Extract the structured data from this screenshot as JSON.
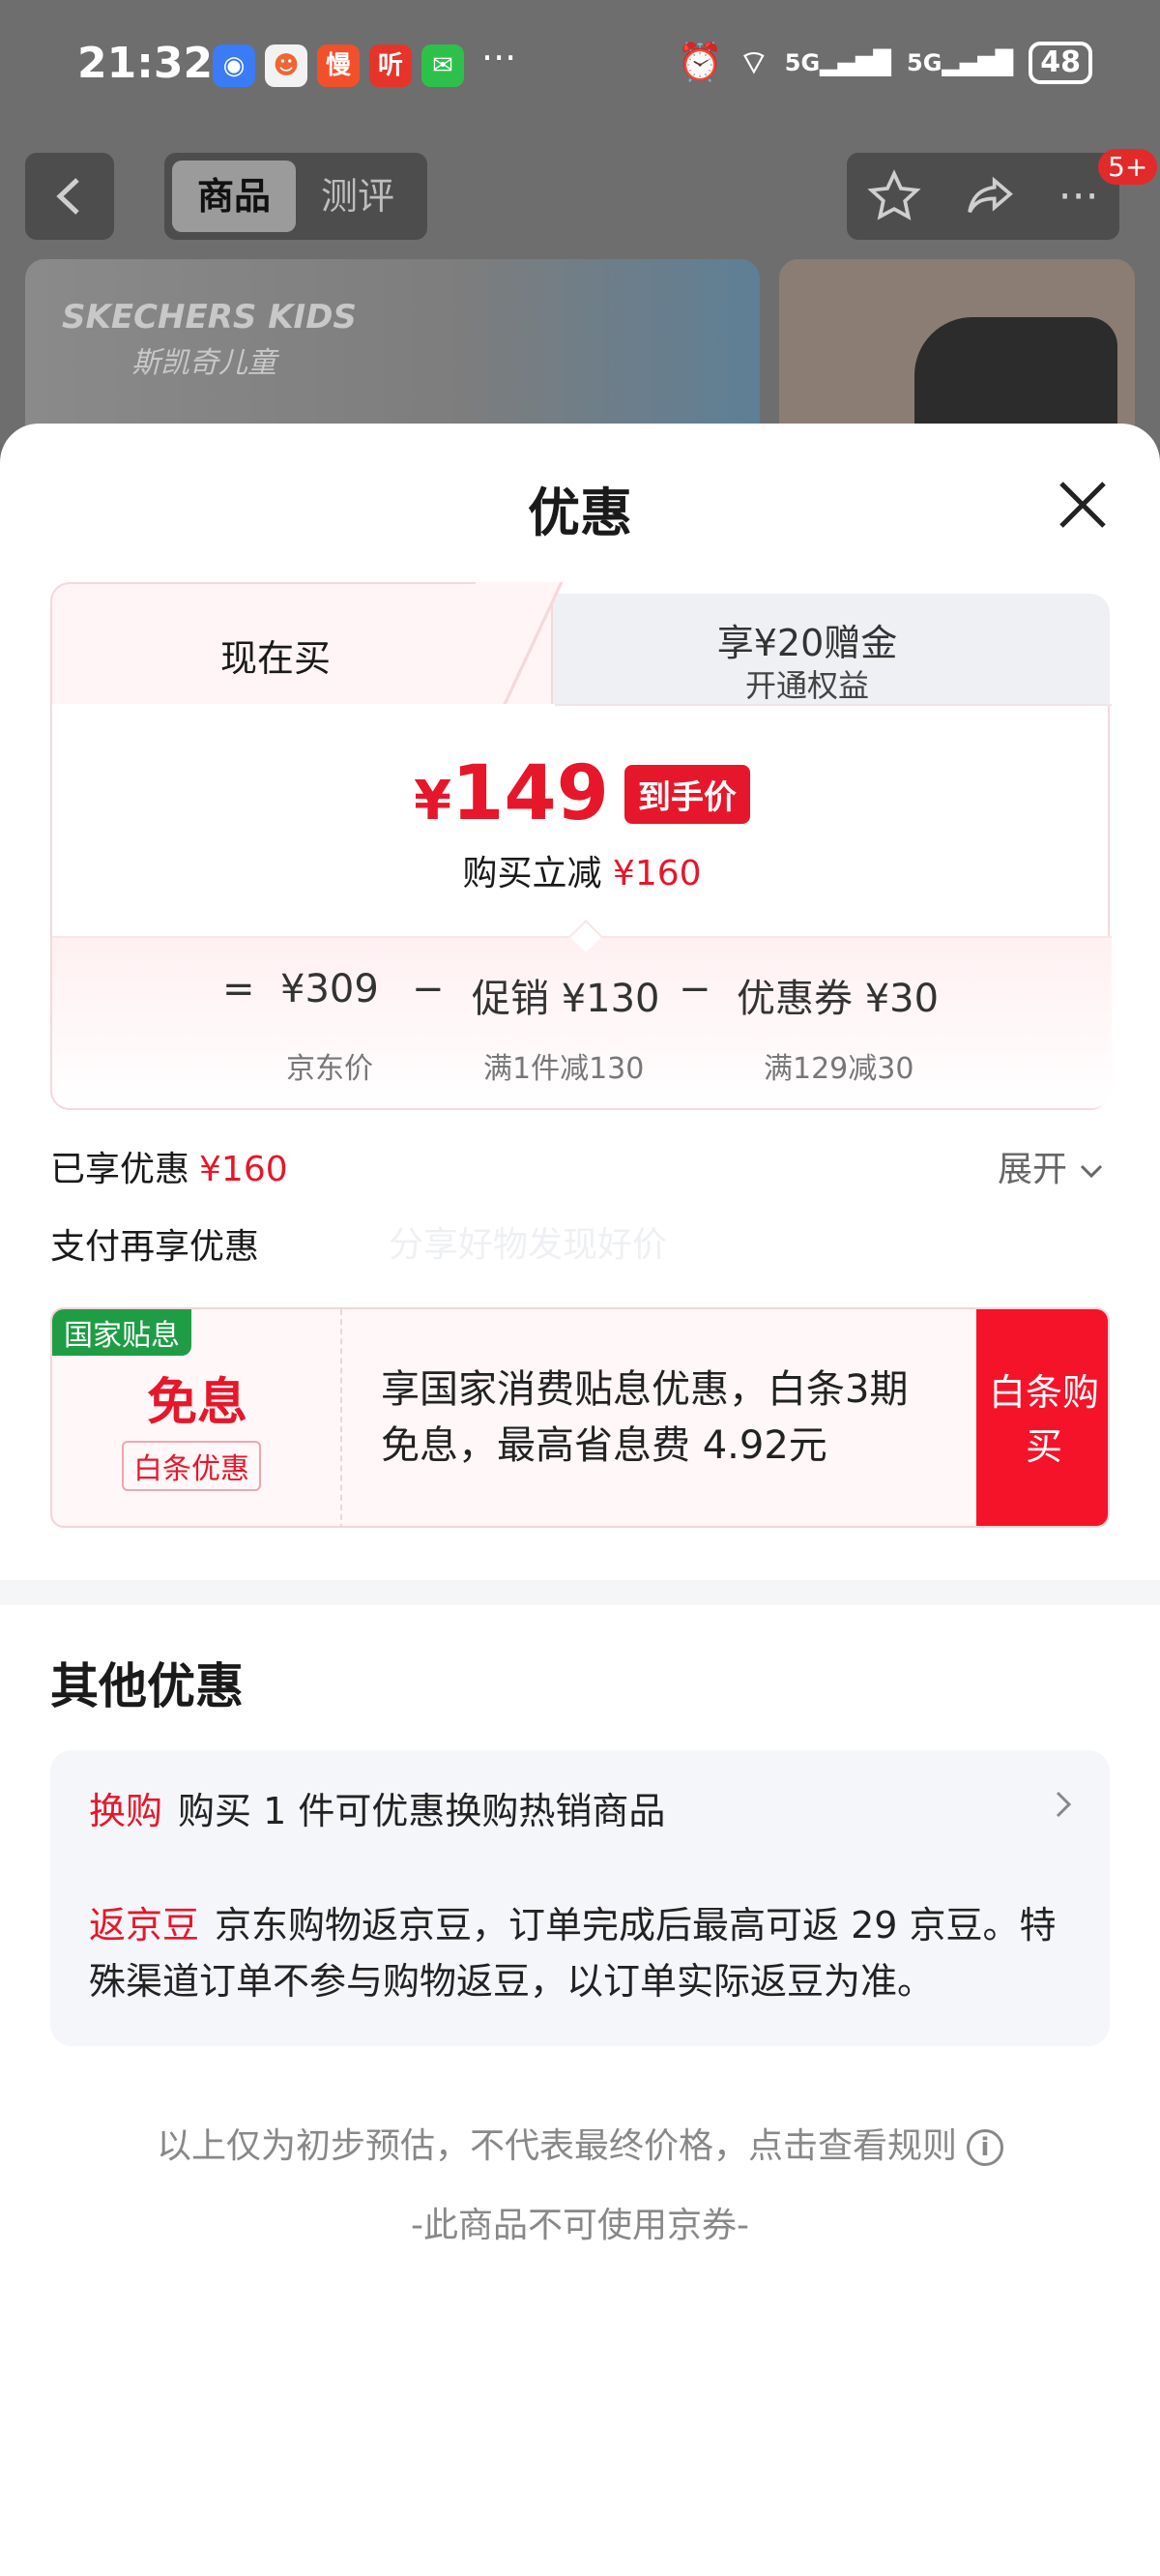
{
  "status_bar": {
    "time": "21:32",
    "app_icons": [
      "browser-icon",
      "mascot-app-icon",
      "慢",
      "听",
      "wechat-icon"
    ],
    "more": "···",
    "battery": "48"
  },
  "topbar": {
    "tabs": [
      "商品",
      "测评"
    ],
    "badge": "5+"
  },
  "sheet": {
    "title": "优惠",
    "tab_now": "现在买",
    "tab_right_line1": "享¥20赠金",
    "tab_right_line2": "开通权益",
    "price_yen": "¥",
    "price_value": "149",
    "price_tag": "到手价",
    "reduce_label": "购买立减",
    "reduce_value": "¥160",
    "formula": {
      "eq": "=",
      "jd_price": "¥309",
      "jd_price_label": "京东价",
      "minus1": "−",
      "promo": "促销 ¥130",
      "promo_label": "满1件减130",
      "minus2": "−",
      "coupon": "优惠券 ¥30",
      "coupon_label": "满129减30"
    },
    "enjoyed_label": "已享优惠",
    "enjoyed_value": "¥160",
    "expand_label": "展开",
    "pay_again_label": "支付再享优惠",
    "watermark": "分享好物发现好价",
    "subsidy": {
      "badge": "国家贴息",
      "big": "免息",
      "small": "白条优惠",
      "desc": "享国家消费贴息优惠，白条3期免息，最高省息费 4.92元",
      "button": "白条购买"
    },
    "other_title": "其他优惠",
    "other": [
      {
        "tag": "换购",
        "text": "购买 1 件可优惠换购热销商品"
      },
      {
        "tag": "返京豆",
        "text": "京东购物返京豆，订单完成后最高可返 29 京豆。特殊渠道订单不参与购物返豆，以订单实际返豆为准。"
      }
    ],
    "footer_note": "以上仅为初步预估，不代表最终价格，点击查看规则",
    "footer_note2": "-此商品不可使用京券-"
  },
  "colors": {
    "accent_red": "#e6172a",
    "green_badge": "#1f9d45"
  }
}
